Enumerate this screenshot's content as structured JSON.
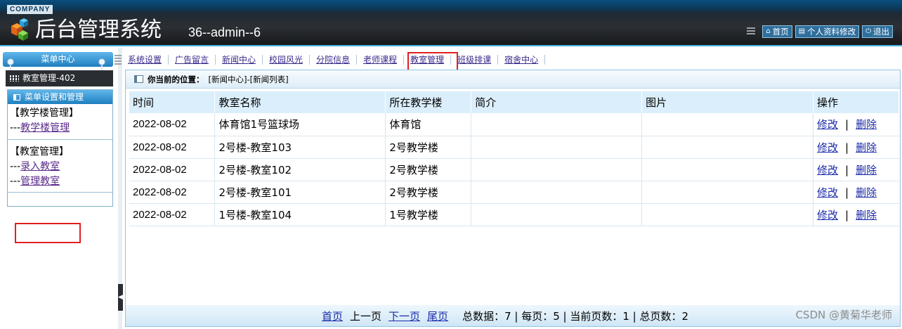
{
  "header": {
    "company": "COMPANY",
    "title": "后台管理系统",
    "user_info": "36--admin--6",
    "links": [
      {
        "label": "首页",
        "icon": "home-icon"
      },
      {
        "label": "个人资料修改",
        "icon": "list-icon"
      },
      {
        "label": "退出",
        "icon": "power-icon"
      }
    ]
  },
  "sidebar": {
    "heading": "菜单中心",
    "current": "教室管理-402",
    "panel_title": "菜单设置和管理",
    "groups": [
      {
        "title": "【教学楼管理】",
        "prefix": "---",
        "items": [
          "教学楼管理"
        ]
      },
      {
        "title": "【教室管理】",
        "prefix": "---",
        "items": [
          "录入教室",
          "管理教室"
        ]
      }
    ]
  },
  "nav": {
    "items": [
      "系统设置",
      "广告留言",
      "新闻中心",
      "校园风光",
      "分院信息",
      "老师课程",
      "教室管理",
      "班级排课",
      "宿舍中心"
    ]
  },
  "breadcrumb": {
    "label": "你当前的位置：",
    "path": "[新闻中心]-[新闻列表]"
  },
  "table": {
    "headers": [
      "时间",
      "教室名称",
      "所在教学楼",
      "简介",
      "图片",
      "操作"
    ],
    "rows": [
      {
        "time": "2022-08-02",
        "name": "体育馆1号篮球场",
        "building": "体育馆",
        "intro": "",
        "image": ""
      },
      {
        "time": "2022-08-02",
        "name": "2号楼-教室103",
        "building": "2号教学楼",
        "intro": "",
        "image": ""
      },
      {
        "time": "2022-08-02",
        "name": "2号楼-教室102",
        "building": "2号教学楼",
        "intro": "",
        "image": ""
      },
      {
        "time": "2022-08-02",
        "name": "2号楼-教室101",
        "building": "2号教学楼",
        "intro": "",
        "image": ""
      },
      {
        "time": "2022-08-02",
        "name": "1号楼-教室104",
        "building": "1号教学楼",
        "intro": "",
        "image": ""
      }
    ],
    "actions": {
      "edit": "修改",
      "separator": "|",
      "delete": "删除"
    }
  },
  "pagination": {
    "first": "首页",
    "prev": "上一页",
    "next": "下一页",
    "last": "尾页",
    "stats": "总数据：7 | 每页：5 | 当前页数：1 | 总页数：2"
  },
  "watermark": "CSDN @黄菊华老师",
  "colors": {
    "highlight_border": "#e02020",
    "link": "#1a2aa8",
    "header_bg": "#2c2f33",
    "accent": "#1f7fc0"
  }
}
